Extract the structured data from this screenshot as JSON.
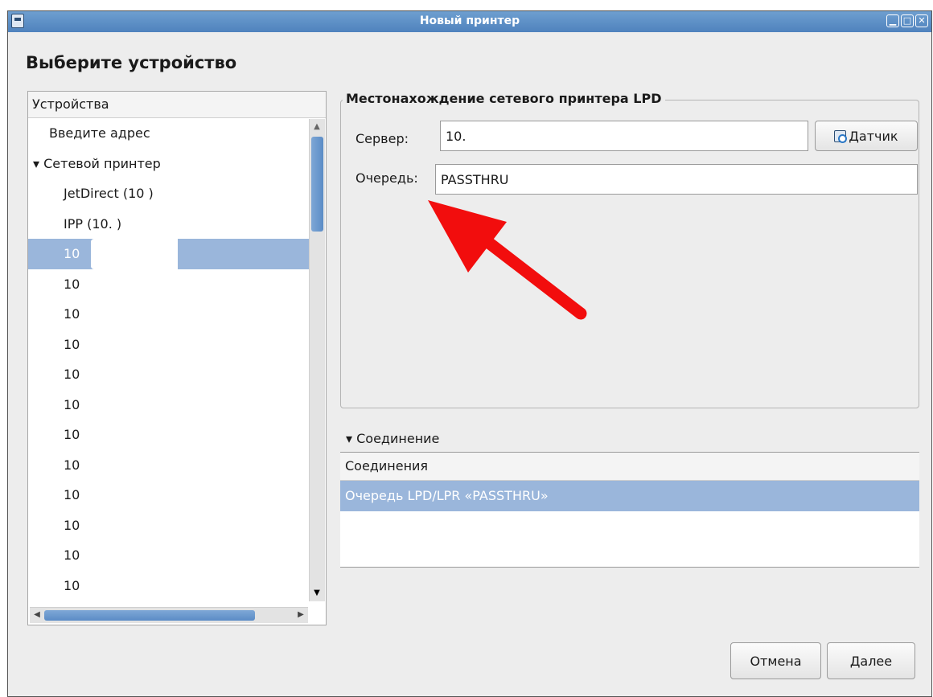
{
  "window": {
    "title": "Новый принтер",
    "controls": [
      "▁",
      "□",
      "✕"
    ]
  },
  "heading": "Выберите устройство",
  "devices": {
    "header": "Устройства",
    "items": [
      {
        "label": "Введите адрес",
        "level": 0
      },
      {
        "label": "▾ Сетевой принтер",
        "level": 0
      },
      {
        "label": "JetDirect (10              )",
        "level": 1
      },
      {
        "label": "IPP (10.              )",
        "level": 1
      },
      {
        "label": "10",
        "level": 1,
        "selected": true
      },
      {
        "label": "10",
        "level": 1
      },
      {
        "label": "10",
        "level": 1
      },
      {
        "label": "10",
        "level": 1
      },
      {
        "label": "10",
        "level": 1
      },
      {
        "label": "10",
        "level": 1
      },
      {
        "label": "10",
        "level": 1
      },
      {
        "label": "10",
        "level": 1
      },
      {
        "label": "10",
        "level": 1
      },
      {
        "label": "10",
        "level": 1
      },
      {
        "label": "10",
        "level": 1
      },
      {
        "label": "10",
        "level": 1
      }
    ]
  },
  "lpd": {
    "group_title": "Местонахождение сетевого принтера LPD",
    "server_label": "Сервер:",
    "server_value": "10.",
    "probe_label": "Датчик",
    "queue_label": "Очередь:",
    "queue_value": "PASSTHRU"
  },
  "connection": {
    "expander_label": "▾ Соединение",
    "header": "Соединения",
    "rows": [
      "Очередь LPD/LPR «PASSTHRU»"
    ]
  },
  "buttons": {
    "cancel": "Отмена",
    "next": "Далее"
  },
  "colors": {
    "titlebar": "#5b8cc6",
    "selection": "#9ab6db",
    "annotation_arrow": "#f20d0d"
  }
}
